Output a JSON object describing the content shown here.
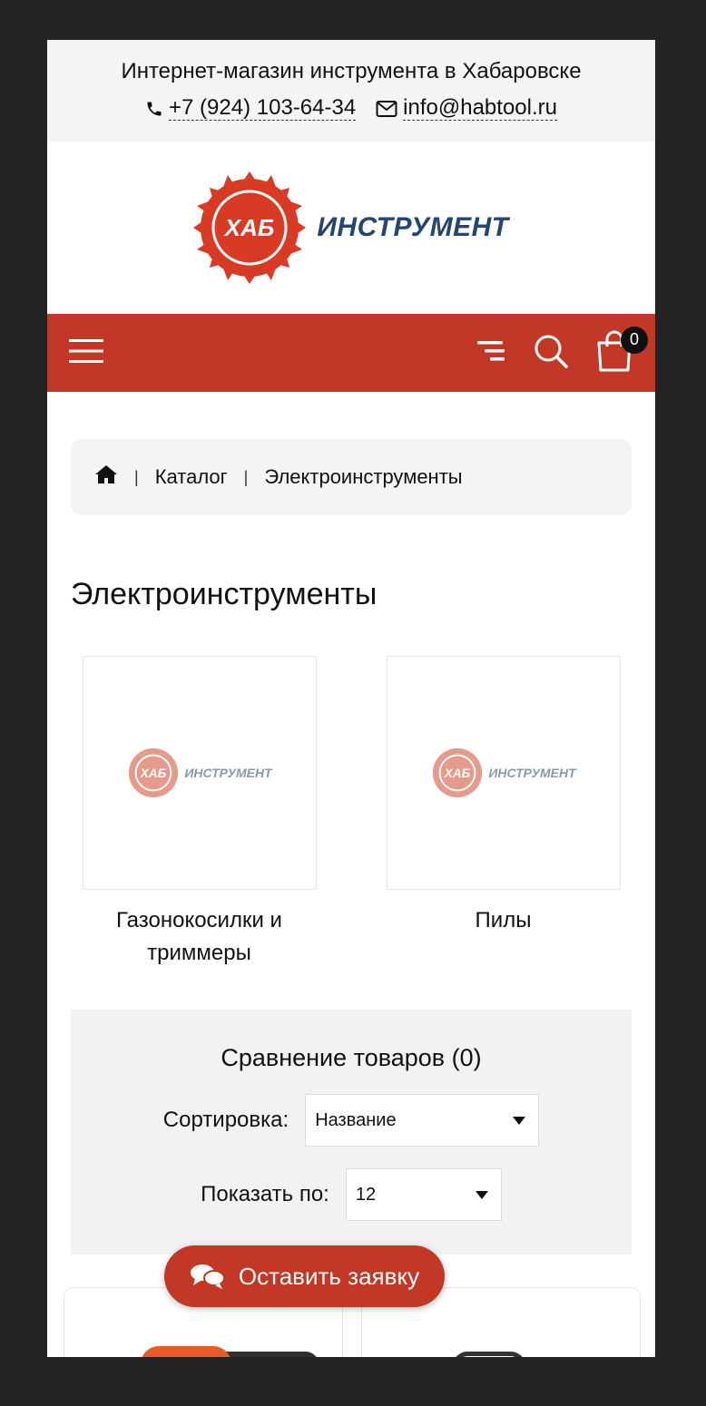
{
  "header": {
    "tagline": "Интернет-магазин инструмента в Хабаровске",
    "phone": "+7 (924) 103-64-34",
    "email": "info@habtool.ru"
  },
  "logo": {
    "badge_text": "ХАБ",
    "brand_text": "ИНСТРУМЕНТ"
  },
  "navbar": {
    "cart_count": "0",
    "color": "#c23726"
  },
  "breadcrumb": {
    "home_icon": "home-icon",
    "items": [
      "Каталог",
      "Электроинструменты"
    ],
    "separator": "|"
  },
  "page_title": "Электроинструменты",
  "categories": [
    {
      "name": "Газонокосилки и триммеры",
      "image": "logo-placeholder"
    },
    {
      "name": "Пилы",
      "image": "logo-placeholder"
    }
  ],
  "controls": {
    "compare_label": "Сравнение товаров (0)",
    "sort_label": "Сортировка:",
    "sort_value": "Название",
    "show_label": "Показать по:",
    "show_value": "12"
  },
  "cta": {
    "label": "Оставить заявку",
    "icon": "chat-icon"
  }
}
